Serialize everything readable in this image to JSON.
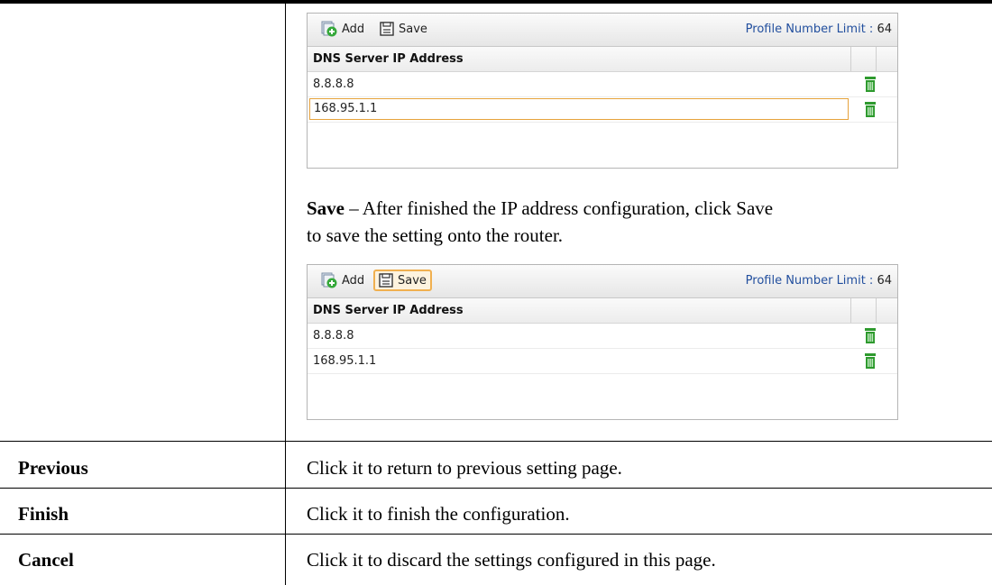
{
  "panel1": {
    "add_label": "Add",
    "save_label": "Save",
    "limit_label": "Profile Number Limit :",
    "limit_value": "64",
    "column_header": "DNS Server IP Address",
    "rows": [
      "8.8.8.8",
      "168.95.1.1"
    ]
  },
  "description": {
    "save_bold": "Save",
    "save_text_line1": " – After finished the IP address configuration, click Save",
    "save_text_line2": "to save the setting onto the router."
  },
  "panel2": {
    "add_label": "Add",
    "save_label": "Save",
    "limit_label": "Profile Number Limit :",
    "limit_value": "64",
    "column_header": "DNS Server IP Address",
    "rows": [
      "8.8.8.8",
      "168.95.1.1"
    ]
  },
  "table_rows": [
    {
      "label": "Previous",
      "desc": "Click it to return to previous setting page."
    },
    {
      "label": "Finish",
      "desc": "Click it to finish the configuration."
    },
    {
      "label": "Cancel",
      "desc": "Click it to discard the settings configured in this page."
    }
  ],
  "colors": {
    "limit_text": "#224f9e",
    "highlight_border": "#f0b050",
    "input_border": "#e6a23c",
    "trash_green": "#2e9a2e"
  },
  "icons": [
    "add-icon",
    "save-icon",
    "trash-icon"
  ]
}
